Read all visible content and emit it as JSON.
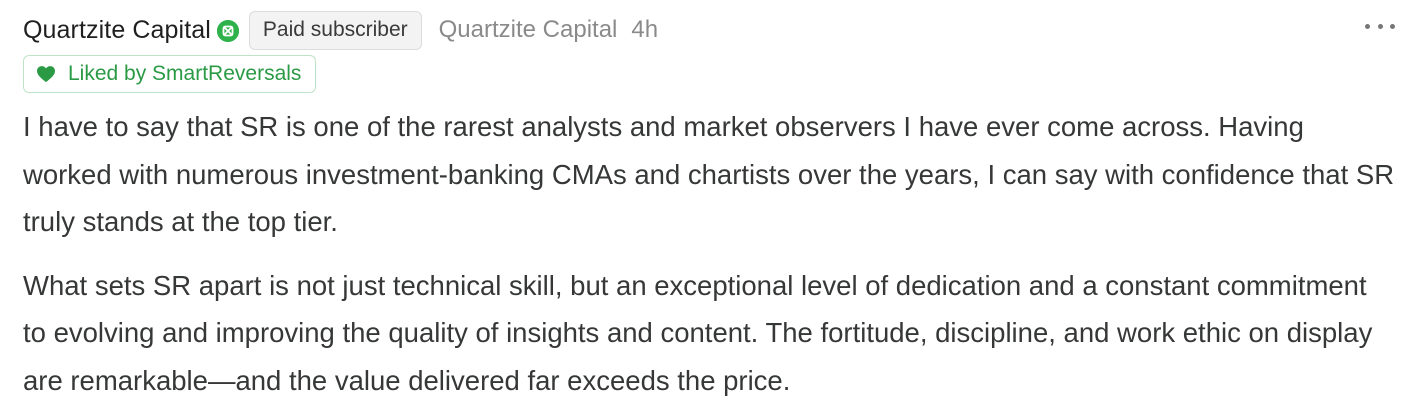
{
  "comment": {
    "author": "Quartzite Capital",
    "badge": "Paid subscriber",
    "publication": "Quartzite Capital",
    "time": "4h",
    "liked_by": "Liked by SmartReversals",
    "paragraphs": [
      "I have to say that SR is one of the rarest analysts and market observers I have ever come across. Having worked with numerous investment-banking CMAs and chartists over the years, I can say with confidence that SR truly stands at the top tier.",
      "What sets SR apart is not just technical skill, but an exceptional level of dedication and a constant commitment to evolving and improving the quality of insights and content. The fortitude, discipline, and work ethic on display are remarkable—and the value delivered far exceeds the price."
    ]
  },
  "icons": {
    "verified": "verified-badge-icon",
    "heart": "heart-icon",
    "more": "more-horizontal-icon"
  },
  "colors": {
    "accent_green": "#2fb24c",
    "liked_text": "#2b9a45",
    "muted_text": "#8a8a8a"
  }
}
